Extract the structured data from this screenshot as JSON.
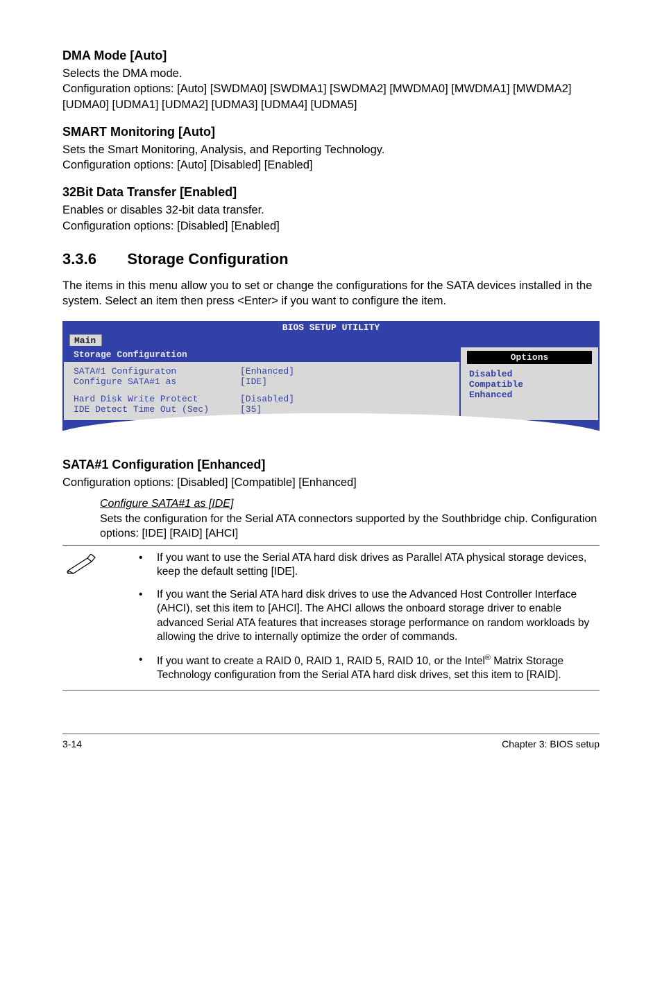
{
  "s1": {
    "h": "DMA Mode [Auto]",
    "l1": "Selects the DMA mode.",
    "l2": "Configuration options: [Auto] [SWDMA0] [SWDMA1] [SWDMA2] [MWDMA0] [MWDMA1] [MWDMA2] [UDMA0] [UDMA1] [UDMA2] [UDMA3] [UDMA4] [UDMA5]"
  },
  "s2": {
    "h": "SMART Monitoring [Auto]",
    "l1": "Sets the Smart Monitoring, Analysis, and Reporting Technology.",
    "l2": "Configuration options: [Auto] [Disabled] [Enabled]"
  },
  "s3": {
    "h": "32Bit Data Transfer [Enabled]",
    "l1": "Enables or disables 32-bit data transfer.",
    "l2": "Configuration options: [Disabled] [Enabled]"
  },
  "sec": {
    "num": "3.3.6",
    "title": "Storage Configuration",
    "intro": "The items in this menu allow you to set or change the configurations for the SATA devices installed in the system. Select an item then press <Enter> if you want to configure the item."
  },
  "bios": {
    "title": "BIOS SETUP UTILITY",
    "tab": "Main",
    "left_header": "Storage Configuration",
    "rows": [
      {
        "label": "SATA#1 Configuraton",
        "val": "[Enhanced]"
      },
      {
        "label": " Configure SATA#1 as",
        "val": "[IDE]"
      }
    ],
    "rows2": [
      {
        "label": "Hard Disk Write Protect",
        "val": "[Disabled]"
      },
      {
        "label": "IDE Detect Time Out (Sec)",
        "val": "[35]"
      }
    ],
    "right_header": "Options",
    "options": [
      "Disabled",
      "Compatible",
      "Enhanced"
    ]
  },
  "sata": {
    "h": "SATA#1 Configuration [Enhanced]",
    "body": "Configuration options: [Disabled] [Compatible] [Enhanced]",
    "sub_h": "Configure SATA#1 as [IDE]",
    "sub_body": "Sets the configuration for the Serial ATA connectors supported by the Southbridge chip. Configuration options: [IDE] [RAID] [AHCI]"
  },
  "notes": {
    "n1": "If you want to use the Serial ATA hard disk drives as Parallel ATA physical storage devices, keep the default setting [IDE].",
    "n2": "If you want the Serial ATA hard disk drives to use the Advanced Host Controller Interface (AHCI), set this item to [AHCI]. The AHCI allows the onboard storage driver to enable advanced Serial ATA features that increases storage performance on random workloads by allowing the drive to internally optimize the order of commands.",
    "n3a": "If you want to create a RAID 0, RAID 1, RAID 5, RAID 10, or the Intel",
    "n3b": " Matrix Storage Technology configuration from the Serial ATA hard disk drives, set this item to [RAID]."
  },
  "footer": {
    "left": "3-14",
    "right": "Chapter 3: BIOS setup"
  }
}
